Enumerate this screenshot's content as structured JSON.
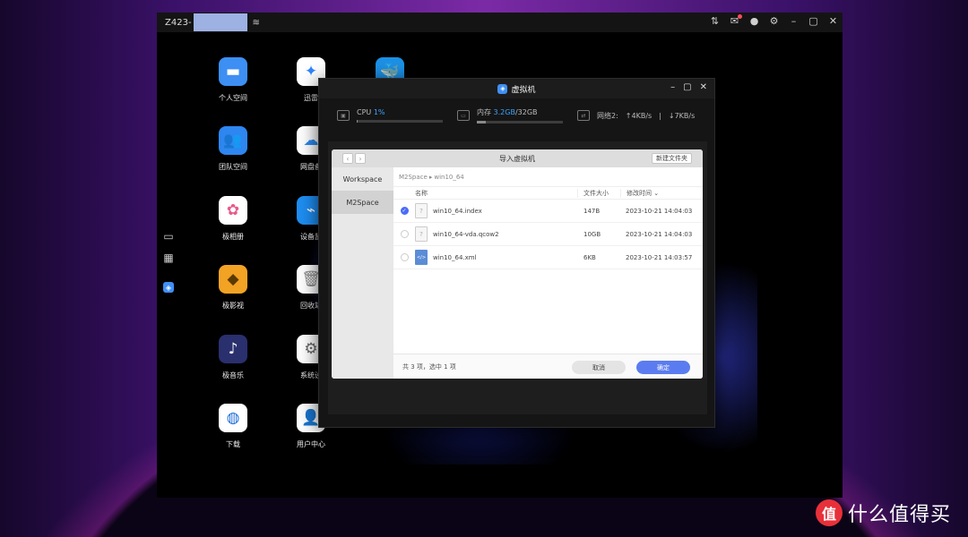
{
  "topbar": {
    "hostname": "Z423-",
    "icons": [
      "wifi-icon",
      "transfer-icon",
      "mail-icon",
      "user-icon",
      "gear-icon",
      "minimize-icon",
      "maximize-icon",
      "close-icon"
    ]
  },
  "desktop_apps": [
    {
      "label": "个人空间",
      "icon": "folder-icon",
      "color": "#3d8ff3"
    },
    {
      "label": "团队空间",
      "icon": "team-folder-icon",
      "color": "#2e86f0"
    },
    {
      "label": "极相册",
      "icon": "photos-icon",
      "color": "#ffffff"
    },
    {
      "label": "极影视",
      "icon": "video-icon",
      "color": "#f2a324"
    },
    {
      "label": "极音乐",
      "icon": "music-icon",
      "color": "#2a2f6e"
    },
    {
      "label": "下载",
      "icon": "globe-icon",
      "color": "#ffffff"
    },
    {
      "label": "迅雷",
      "icon": "thunder-icon",
      "color": "#ffffff"
    },
    {
      "label": "网盘备",
      "icon": "cloud-backup-icon",
      "color": "#ffffff"
    },
    {
      "label": "设备监",
      "icon": "monitor-icon",
      "color": "#1e8ef2"
    },
    {
      "label": "回收站",
      "icon": "trash-icon",
      "color": "#ffffff"
    },
    {
      "label": "系统设",
      "icon": "settings-icon",
      "color": "#ffffff"
    },
    {
      "label": "用户中心",
      "icon": "user-center-icon",
      "color": "#ffffff"
    },
    {
      "label": "",
      "icon": "docker-icon",
      "color": "#1d91e6"
    }
  ],
  "vm_window": {
    "title": "虚拟机",
    "cpu": {
      "label": "CPU",
      "value": "1%",
      "fraction": 0.01
    },
    "memory": {
      "label": "内存",
      "used": "3.2GB",
      "sep": "/",
      "total": "32GB",
      "fraction": 0.1
    },
    "network": {
      "label": "网络2:",
      "up": "↑4KB/s",
      "sep": "|",
      "down": "↓7KB/s"
    }
  },
  "dialog": {
    "title": "导入虚拟机",
    "new_folder": "新建文件夹",
    "sidebar": [
      "Workspace",
      "M2Space"
    ],
    "breadcrumb": [
      "M2Space",
      "win10_64"
    ],
    "columns": {
      "name": "名称",
      "size": "文件大小",
      "time": "修改时间"
    },
    "files": [
      {
        "name": "win10_64.index",
        "size": "147B",
        "time": "2023-10-21 14:04:03",
        "selected": true,
        "type": "unknown"
      },
      {
        "name": "win10_64-vda.qcow2",
        "size": "10GB",
        "time": "2023-10-21 14:04:03",
        "selected": false,
        "type": "unknown"
      },
      {
        "name": "win10_64.xml",
        "size": "6KB",
        "time": "2023-10-21 14:03:57",
        "selected": false,
        "type": "xml"
      }
    ],
    "summary": "共 3 项，选中 1 项",
    "cancel": "取消",
    "confirm": "确定"
  },
  "watermark": {
    "logo": "值",
    "text": "什么值得买"
  }
}
